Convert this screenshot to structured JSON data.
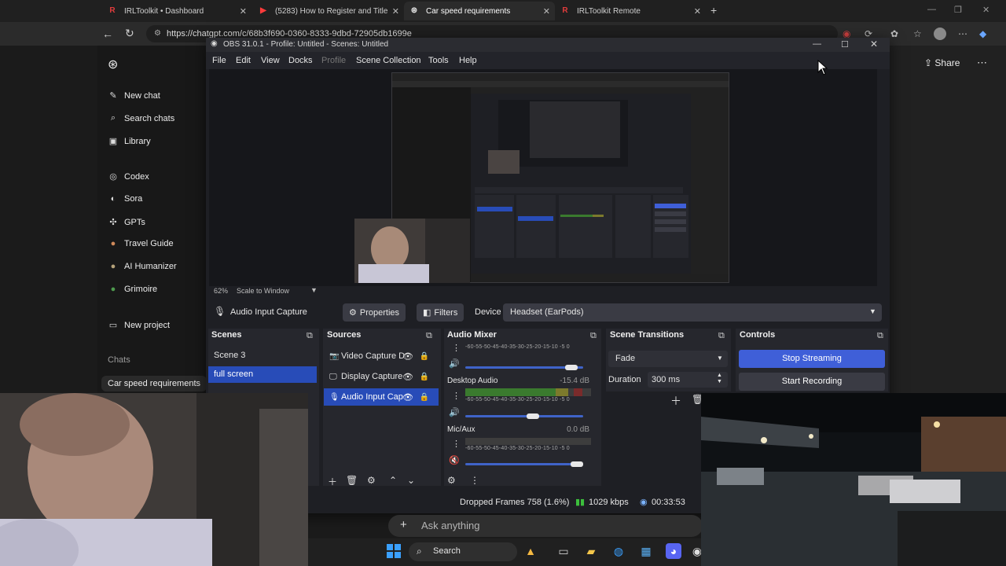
{
  "browser": {
    "tabs": [
      {
        "label": "IRLToolkit • Dashboard",
        "icon": "irltoolkit-icon"
      },
      {
        "label": "(5283) How to Register and Title",
        "icon": "youtube-icon"
      },
      {
        "label": "Car speed requirements",
        "icon": "chatgpt-icon"
      },
      {
        "label": "IRLToolkit Remote",
        "icon": "irltoolkit-icon"
      }
    ],
    "url": "https://chatgpt.com/c/68b3f690-0360-8333-9dbd-72905db1699e"
  },
  "chatgpt": {
    "sidebar": {
      "items": [
        {
          "label": "New chat",
          "icon": "edit-icon"
        },
        {
          "label": "Search chats",
          "icon": "search-icon"
        },
        {
          "label": "Library",
          "icon": "library-icon"
        },
        {
          "label": "Codex",
          "icon": "codex-icon"
        },
        {
          "label": "Sora",
          "icon": "sora-icon"
        },
        {
          "label": "GPTs",
          "icon": "gpts-icon"
        },
        {
          "label": "Travel Guide",
          "icon": "gpt-avatar-icon"
        },
        {
          "label": "AI Humanizer",
          "icon": "gpt-avatar-icon"
        },
        {
          "label": "Grimoire",
          "icon": "gpt-avatar-icon"
        },
        {
          "label": "New project",
          "icon": "folder-plus-icon"
        }
      ],
      "chats_heading": "Chats",
      "chats": [
        "Car speed requirements"
      ]
    },
    "share_label": "Share",
    "ask_placeholder": "Ask anything"
  },
  "obs": {
    "title": "OBS 31.0.1 - Profile: Untitled - Scenes: Untitled",
    "menu": [
      "File",
      "Edit",
      "View",
      "Docks",
      "Profile",
      "Scene Collection",
      "Tools",
      "Help"
    ],
    "zoom": "62%",
    "zoom_mode": "Scale to Window",
    "source_toolbar": {
      "source_name": "Audio Input Capture",
      "properties": "Properties",
      "filters": "Filters",
      "device_label": "Device",
      "device_value": "Headset (EarPods)"
    },
    "docks": {
      "scenes": {
        "title": "Scenes",
        "items": [
          "Scene 3",
          "full screen"
        ],
        "selected": 1
      },
      "sources": {
        "title": "Sources",
        "items": [
          {
            "label": "Video Capture D",
            "icon": "camera-icon"
          },
          {
            "label": "Display Capture",
            "icon": "monitor-icon"
          },
          {
            "label": "Audio Input Cap",
            "icon": "microphone-icon"
          }
        ],
        "selected": 2
      },
      "mixer": {
        "title": "Audio Mixer",
        "scale": "-60-55-50-45-40-35-30-25-20-15-10 -5 0",
        "channels": [
          {
            "name": "",
            "db": "",
            "level": 0.0,
            "volume": 0.95
          },
          {
            "name": "Desktop Audio",
            "db": "-15.4 dB",
            "level": 0.82,
            "volume": 0.58
          },
          {
            "name": "Mic/Aux",
            "db": "0.0 dB",
            "level": 0.0,
            "volume": 1.0
          }
        ]
      },
      "transitions": {
        "title": "Scene Transitions",
        "type": "Fade",
        "duration_label": "Duration",
        "duration_value": "300 ms"
      },
      "controls": {
        "title": "Controls",
        "stop_streaming": "Stop Streaming",
        "start_recording": "Start Recording"
      }
    },
    "status": {
      "dropped": "Dropped Frames 758 (1.6%)",
      "bitrate": "1029 kbps",
      "time": "00:33:53"
    }
  },
  "taskbar": {
    "search_label": "Search"
  },
  "colors": {
    "obs_accent": "#284cb8",
    "stop_streaming": "#3f5fd8",
    "start_recording": "#3a3b44"
  }
}
